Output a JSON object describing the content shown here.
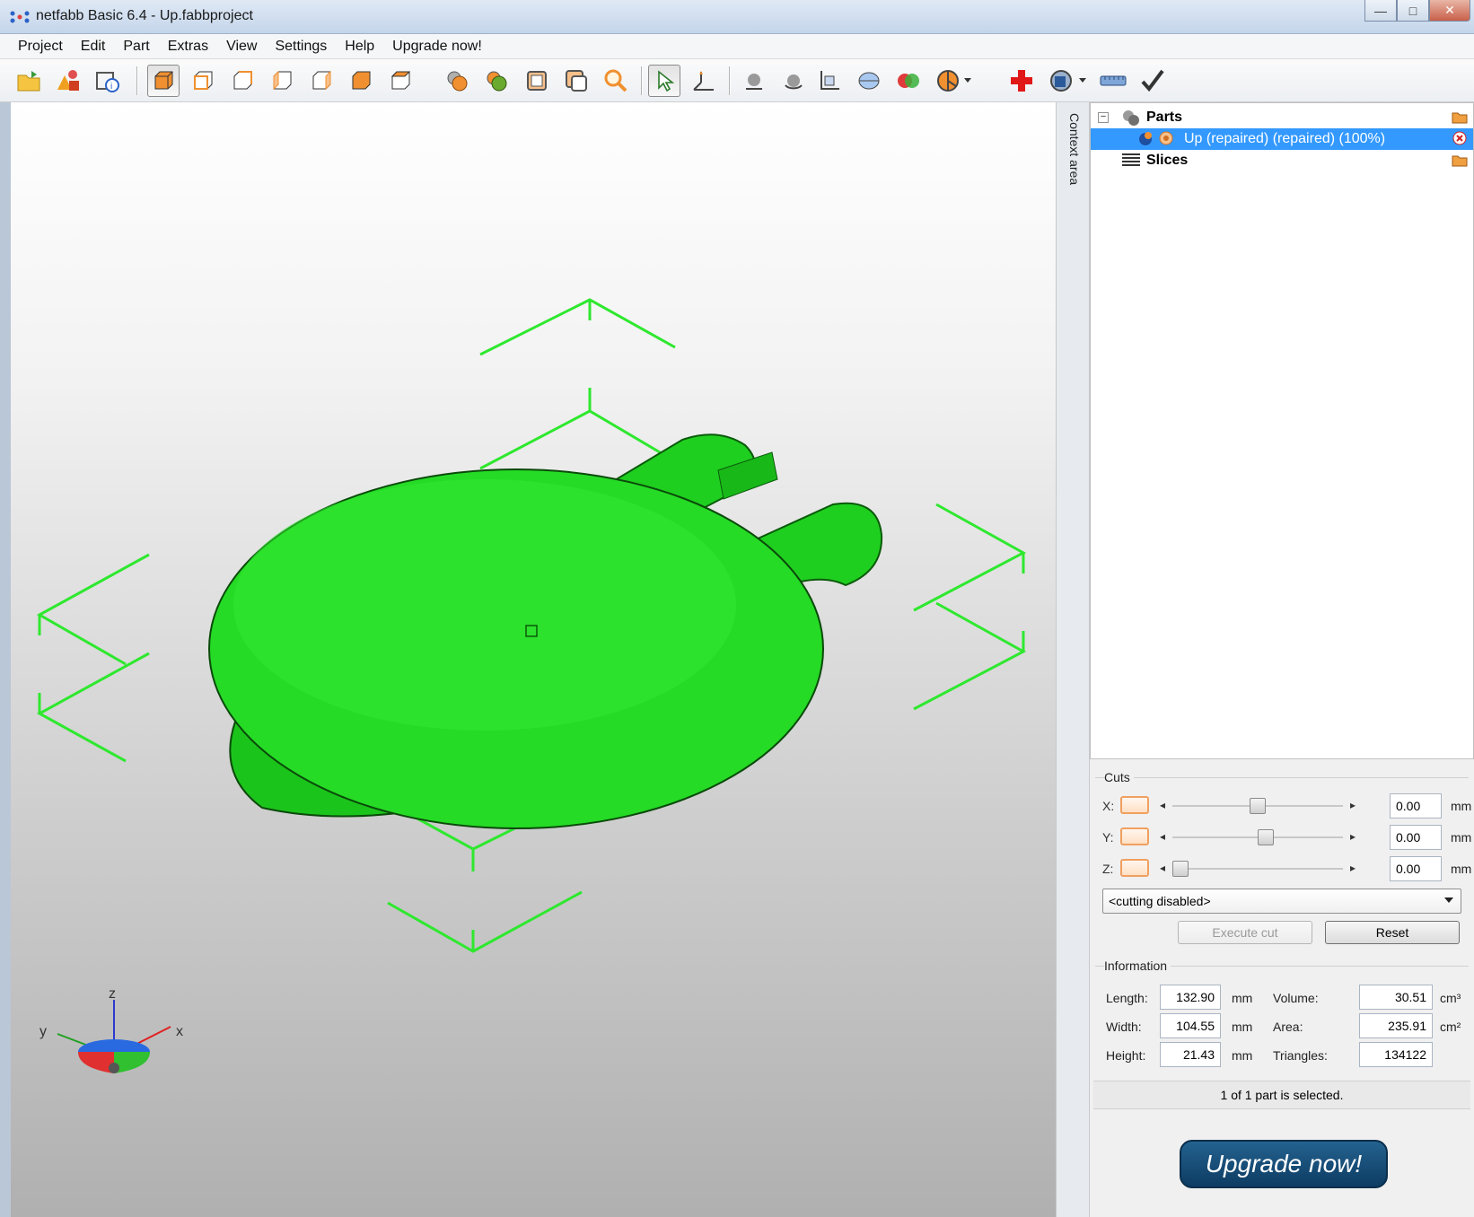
{
  "window": {
    "title": "netfabb Basic 6.4 - Up.fabbproject",
    "minimize_glyph": "—",
    "maximize_glyph": "□",
    "close_glyph": "✕"
  },
  "menu": [
    "Project",
    "Edit",
    "Part",
    "Extras",
    "View",
    "Settings",
    "Help",
    "Upgrade now!"
  ],
  "toolbar_icons": [
    "open-project-icon",
    "add-part-icon",
    "part-info-icon",
    "view-perspective-icon",
    "view-front-icon",
    "view-back-icon",
    "view-left-icon",
    "view-right-icon",
    "view-top-icon",
    "view-bottom-icon",
    "render-mode-icon",
    "shaded-icon",
    "wireframe-icon",
    "box-view-icon",
    "zoom-icon",
    "select-pointer-icon",
    "measure-icon",
    "move-icon",
    "rotate-icon",
    "scale-icon",
    "mirror-icon",
    "boolean-icon",
    "pie-view-icon",
    "repair-cross-icon",
    "analysis-icon",
    "ruler-icon",
    "check-icon"
  ],
  "viewport": {
    "model_color": "#22dd22",
    "axis_x": "x",
    "axis_y": "y",
    "axis_z": "z"
  },
  "context_area": {
    "label": "Context area"
  },
  "tree": {
    "parts_label": "Parts",
    "part_item_label": "Up (repaired) (repaired) (100%)",
    "slices_label": "Slices",
    "expander_glyph": "−"
  },
  "cuts": {
    "title": "Cuts",
    "rows": [
      {
        "axis": "X:",
        "value": "0.00",
        "unit": "mm",
        "slider_position": 0.5
      },
      {
        "axis": "Y:",
        "value": "0.00",
        "unit": "mm",
        "slider_position": 0.55
      },
      {
        "axis": "Z:",
        "value": "0.00",
        "unit": "mm",
        "slider_position": 0.0
      }
    ],
    "left_arrow": "◂",
    "right_arrow": "▸",
    "mode": "<cutting disabled>",
    "execute_label": "Execute cut",
    "reset_label": "Reset"
  },
  "information": {
    "title": "Information",
    "length_label": "Length:",
    "length_value": "132.90",
    "length_unit": "mm",
    "width_label": "Width:",
    "width_value": "104.55",
    "width_unit": "mm",
    "height_label": "Height:",
    "height_value": "21.43",
    "height_unit": "mm",
    "volume_label": "Volume:",
    "volume_value": "30.51",
    "volume_unit": "cm³",
    "area_label": "Area:",
    "area_value": "235.91",
    "area_unit": "cm²",
    "triangles_label": "Triangles:",
    "triangles_value": "134122"
  },
  "status": {
    "text": "1 of 1 part is selected."
  },
  "upgrade": {
    "label": "Upgrade now!"
  }
}
